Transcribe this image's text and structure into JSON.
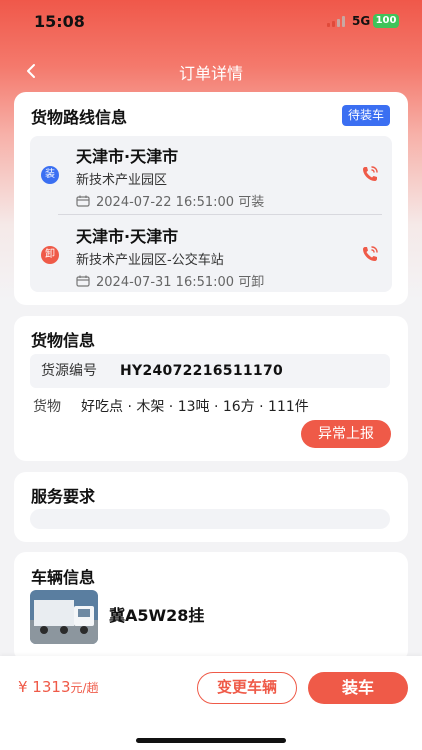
{
  "status_bar": {
    "time": "15:08",
    "network": "5G",
    "battery": "100"
  },
  "nav": {
    "title": "订单详情",
    "back_icon": "chevron-left-icon"
  },
  "route_card": {
    "title": "货物路线信息",
    "status_badge": "待装车",
    "stops": [
      {
        "tag": "装",
        "tag_color": "#3b6ff2",
        "city": "天津市·天津市",
        "address": "新技术产业园区",
        "time": "2024-07-22 16:51:00 可装"
      },
      {
        "tag": "卸",
        "tag_color": "#ef5a48",
        "city": "天津市·天津市",
        "address": "新技术产业园区-公交车站",
        "time": "2024-07-31 16:51:00 可卸"
      }
    ]
  },
  "cargo_card": {
    "title": "货物信息",
    "source_label": "货源编号",
    "source_value": "HY24072216511170",
    "goods_label": "货物",
    "goods_value": "好吃点 · 木架 · 13吨 · 16方 · 111件",
    "report_button": "异常上报"
  },
  "service_card": {
    "title": "服务要求"
  },
  "vehicle_card": {
    "title": "车辆信息",
    "plate": "冀A5W28挂"
  },
  "bottom_bar": {
    "price": "¥ 1313",
    "price_unit": "元/趟",
    "change_button": "变更车辆",
    "load_button": "装车"
  },
  "colors": {
    "accent": "#ef5a48",
    "badge_blue": "#3b6ff2"
  }
}
